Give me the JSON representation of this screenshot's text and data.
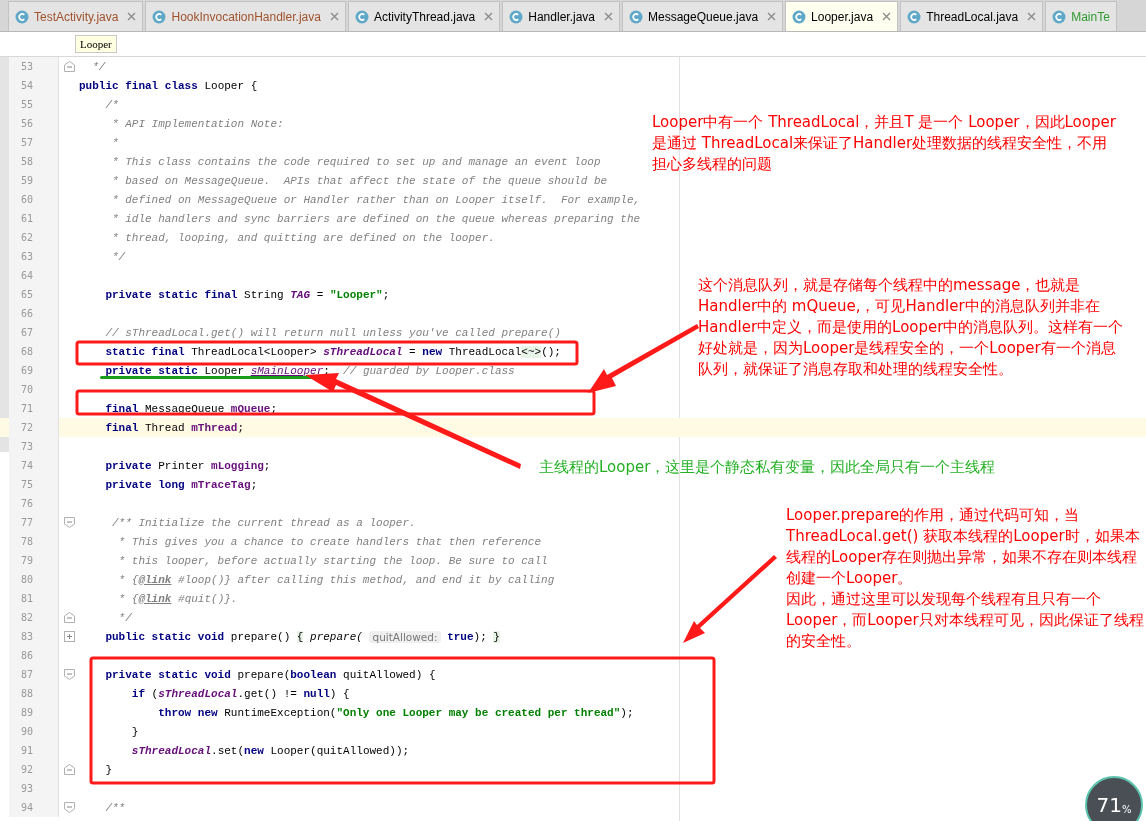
{
  "tabs": [
    {
      "label": "TestActivity.java",
      "selected": false,
      "color": "#a0522d",
      "closable": true
    },
    {
      "label": "HookInvocationHandler.java",
      "selected": false,
      "color": "#a0522d",
      "closable": true
    },
    {
      "label": "ActivityThread.java",
      "selected": false,
      "color": "#000000",
      "closable": true
    },
    {
      "label": "Handler.java",
      "selected": false,
      "color": "#000000",
      "closable": true
    },
    {
      "label": "MessageQueue.java",
      "selected": false,
      "color": "#000000",
      "closable": true
    },
    {
      "label": "Looper.java",
      "selected": true,
      "color": "#000000",
      "closable": true
    },
    {
      "label": "ThreadLocal.java",
      "selected": false,
      "color": "#000000",
      "closable": true
    },
    {
      "label": "MainTe",
      "selected": false,
      "color": "#2e9b2e",
      "closable": false
    }
  ],
  "tooltip": "Looper",
  "lines": [
    {
      "number": "53",
      "fold_start": false,
      "fold_end": true,
      "collapsed": false,
      "tokens": [
        {
          "kind": "comment",
          "text": "  */"
        }
      ]
    },
    {
      "number": "54",
      "tokens": [
        {
          "kind": "keyword",
          "text": "public final class"
        },
        {
          "kind": "plain",
          "text": " Looper {"
        }
      ]
    },
    {
      "number": "55",
      "tokens": [
        {
          "kind": "comment",
          "text": "    /*"
        }
      ]
    },
    {
      "number": "56",
      "tokens": [
        {
          "kind": "comment",
          "text": "     * API Implementation Note:"
        }
      ]
    },
    {
      "number": "57",
      "tokens": [
        {
          "kind": "comment",
          "text": "     *"
        }
      ]
    },
    {
      "number": "58",
      "tokens": [
        {
          "kind": "comment",
          "text": "     * This class contains the code required to set up and manage an event loop"
        }
      ]
    },
    {
      "number": "59",
      "tokens": [
        {
          "kind": "comment",
          "text": "     * based on MessageQueue.  APIs that affect the state of the queue should be"
        }
      ]
    },
    {
      "number": "60",
      "tokens": [
        {
          "kind": "comment",
          "text": "     * defined on MessageQueue or Handler rather than on Looper itself.  For example,"
        }
      ]
    },
    {
      "number": "61",
      "tokens": [
        {
          "kind": "comment",
          "text": "     * idle handlers and sync barriers are defined on the queue whereas preparing the"
        }
      ]
    },
    {
      "number": "62",
      "tokens": [
        {
          "kind": "comment",
          "text": "     * thread, looping, and quitting are defined on the looper."
        }
      ]
    },
    {
      "number": "63",
      "tokens": [
        {
          "kind": "comment",
          "text": "     */"
        }
      ]
    },
    {
      "number": "64"
    },
    {
      "number": "65",
      "tokens": [
        {
          "kind": "keyword",
          "text": "    private static final"
        },
        {
          "kind": "plain",
          "text": " String "
        },
        {
          "kind": "static-field",
          "text": "TAG"
        },
        {
          "kind": "plain",
          "text": " = "
        },
        {
          "kind": "string",
          "text": "\"Looper\""
        },
        {
          "kind": "plain",
          "text": ";"
        }
      ]
    },
    {
      "number": "66"
    },
    {
      "number": "67",
      "tokens": [
        {
          "kind": "comment",
          "text": "    // sThreadLocal.get() will return null unless you've called prepare()"
        }
      ]
    },
    {
      "number": "68",
      "tokens": [
        {
          "kind": "keyword",
          "text": "    static final"
        },
        {
          "kind": "plain",
          "text": " ThreadLocal<Looper> "
        },
        {
          "kind": "static-field",
          "text": "sThreadLocal"
        },
        {
          "kind": "plain",
          "text": " = "
        },
        {
          "kind": "keyword",
          "text": "new"
        },
        {
          "kind": "plain",
          "text": " ThreadLocal"
        },
        {
          "kind": "folded",
          "text": "<~>"
        },
        {
          "kind": "plain",
          "text": "();"
        }
      ]
    },
    {
      "number": "69",
      "tokens": [
        {
          "kind": "keyword",
          "text": "    private static"
        },
        {
          "kind": "plain",
          "text": " Looper "
        },
        {
          "kind": "unused-field",
          "text": "sMainLooper"
        },
        {
          "kind": "plain",
          "text": ";  "
        },
        {
          "kind": "comment",
          "text": "// guarded by Looper.class"
        }
      ]
    },
    {
      "number": "70"
    },
    {
      "number": "71",
      "tokens": [
        {
          "kind": "keyword",
          "text": "    final"
        },
        {
          "kind": "plain",
          "text": " MessageQueue "
        },
        {
          "kind": "field",
          "text": "mQueue"
        },
        {
          "kind": "plain",
          "text": ";"
        }
      ]
    },
    {
      "number": "72",
      "current": true,
      "tokens": [
        {
          "kind": "keyword",
          "text": "    final"
        },
        {
          "kind": "plain",
          "text": " Thread "
        },
        {
          "kind": "field",
          "text": "mThread"
        },
        {
          "kind": "plain",
          "text": ";"
        }
      ]
    },
    {
      "number": "73"
    },
    {
      "number": "74",
      "tokens": [
        {
          "kind": "keyword",
          "text": "    private"
        },
        {
          "kind": "plain",
          "text": " Printer "
        },
        {
          "kind": "field",
          "text": "mLogging"
        },
        {
          "kind": "plain",
          "text": ";"
        }
      ]
    },
    {
      "number": "75",
      "tokens": [
        {
          "kind": "keyword",
          "text": "    private long "
        },
        {
          "kind": "field",
          "text": "mTraceTag"
        },
        {
          "kind": "plain",
          "text": ";"
        }
      ]
    },
    {
      "number": "76"
    },
    {
      "number": "77",
      "fold_start": true,
      "fold_end": false,
      "collapsed": false,
      "tokens": [
        {
          "kind": "comment",
          "text": "     /** Initialize the current thread as a looper."
        }
      ]
    },
    {
      "number": "78",
      "tokens": [
        {
          "kind": "comment",
          "text": "      * This gives you a chance to create handlers that then reference"
        }
      ]
    },
    {
      "number": "79",
      "tokens": [
        {
          "kind": "comment",
          "text": "      * this looper, before actually starting the loop. Be sure to call"
        }
      ]
    },
    {
      "number": "80",
      "tokens": [
        {
          "kind": "comment",
          "text": "      * {"
        },
        {
          "kind": "doc-tag",
          "text": "@link"
        },
        {
          "kind": "comment",
          "text": " #loop()} after calling this method, and end it by calling"
        }
      ]
    },
    {
      "number": "81",
      "tokens": [
        {
          "kind": "comment",
          "text": "      * {"
        },
        {
          "kind": "doc-tag",
          "text": "@link"
        },
        {
          "kind": "comment",
          "text": " #quit()}."
        }
      ]
    },
    {
      "number": "82",
      "fold_start": false,
      "fold_end": true,
      "collapsed": false,
      "tokens": [
        {
          "kind": "comment",
          "text": "      */"
        }
      ]
    },
    {
      "number": "83",
      "fold_start": false,
      "fold_end": false,
      "collapsed": true,
      "tokens": [
        {
          "kind": "keyword",
          "text": "    public static void"
        },
        {
          "kind": "plain",
          "text": " prepare() "
        },
        {
          "kind": "folded",
          "text": "{"
        },
        {
          "kind": "call",
          "text": " prepare( "
        },
        {
          "kind": "hint",
          "text": "quitAllowed:"
        },
        {
          "kind": "keyword",
          "text": " true"
        },
        {
          "kind": "plain",
          "text": "); "
        },
        {
          "kind": "folded",
          "text": "}"
        }
      ]
    },
    {
      "number": "86"
    },
    {
      "number": "87",
      "fold_start": true,
      "fold_end": false,
      "collapsed": false,
      "tokens": [
        {
          "kind": "keyword",
          "text": "    private static void"
        },
        {
          "kind": "plain",
          "text": " prepare("
        },
        {
          "kind": "keyword",
          "text": "boolean"
        },
        {
          "kind": "plain",
          "text": " quitAllowed) {"
        }
      ]
    },
    {
      "number": "88",
      "tokens": [
        {
          "kind": "keyword",
          "text": "        if"
        },
        {
          "kind": "plain",
          "text": " ("
        },
        {
          "kind": "static-field",
          "text": "sThreadLocal"
        },
        {
          "kind": "plain",
          "text": ".get() != "
        },
        {
          "kind": "keyword",
          "text": "null"
        },
        {
          "kind": "plain",
          "text": ") {"
        }
      ]
    },
    {
      "number": "89",
      "tokens": [
        {
          "kind": "keyword",
          "text": "            throw new"
        },
        {
          "kind": "plain",
          "text": " RuntimeException("
        },
        {
          "kind": "string",
          "text": "\"Only one Looper may be created per thread\""
        },
        {
          "kind": "plain",
          "text": ");"
        }
      ]
    },
    {
      "number": "90",
      "tokens": [
        {
          "kind": "plain",
          "text": "        }"
        }
      ]
    },
    {
      "number": "91",
      "tokens": [
        {
          "kind": "static-field",
          "text": "        sThreadLocal"
        },
        {
          "kind": "plain",
          "text": ".set("
        },
        {
          "kind": "keyword",
          "text": "new"
        },
        {
          "kind": "plain",
          "text": " Looper(quitAllowed));"
        }
      ]
    },
    {
      "number": "92",
      "fold_start": false,
      "fold_end": true,
      "collapsed": false,
      "tokens": [
        {
          "kind": "plain",
          "text": "    }"
        }
      ]
    },
    {
      "number": "93"
    },
    {
      "number": "94",
      "fold_start": true,
      "fold_end": false,
      "collapsed": false,
      "tokens": [
        {
          "kind": "comment",
          "text": "    /**"
        }
      ]
    }
  ],
  "notes": [
    {
      "text": "Looper中有一个 ThreadLocal，并且T 是一个 Looper，因此Looper是通过 ThreadLocal来保证了Handler处理数据的线程安全性，不用担心多线程的问题",
      "color": "#ff0000"
    },
    {
      "text": "这个消息队列，就是存储每个线程中的message，也就是Handler中的 mQueue,，可见Handler中的消息队列并非在Handler中定义，而是使用的Looper中的消息队列。这样有一个好处就是，因为Looper是线程安全的，一个Looper有一个消息队列，就保证了消息存取和处理的线程安全性。",
      "color": "#ff0000"
    },
    {
      "text": "主线程的Looper，这里是个静态私有变量，因此全局只有一个主线程",
      "color": "#22b022"
    },
    {
      "text": "Looper.prepare的作用，通过代码可知，当ThreadLocal.get() 获取本线程的Looper时，如果本线程的Looper存在则抛出异常，如果不存在则本线程创建一个Looper。",
      "color": "#ff0000"
    },
    {
      "text": "因此，通过这里可以发现每个线程有且只有一个Looper，而Looper只对本线程可见，因此保证了线程的安全性。",
      "color": "#ff0000"
    }
  ],
  "memory_gauge": {
    "value": "71",
    "unit": "%"
  }
}
